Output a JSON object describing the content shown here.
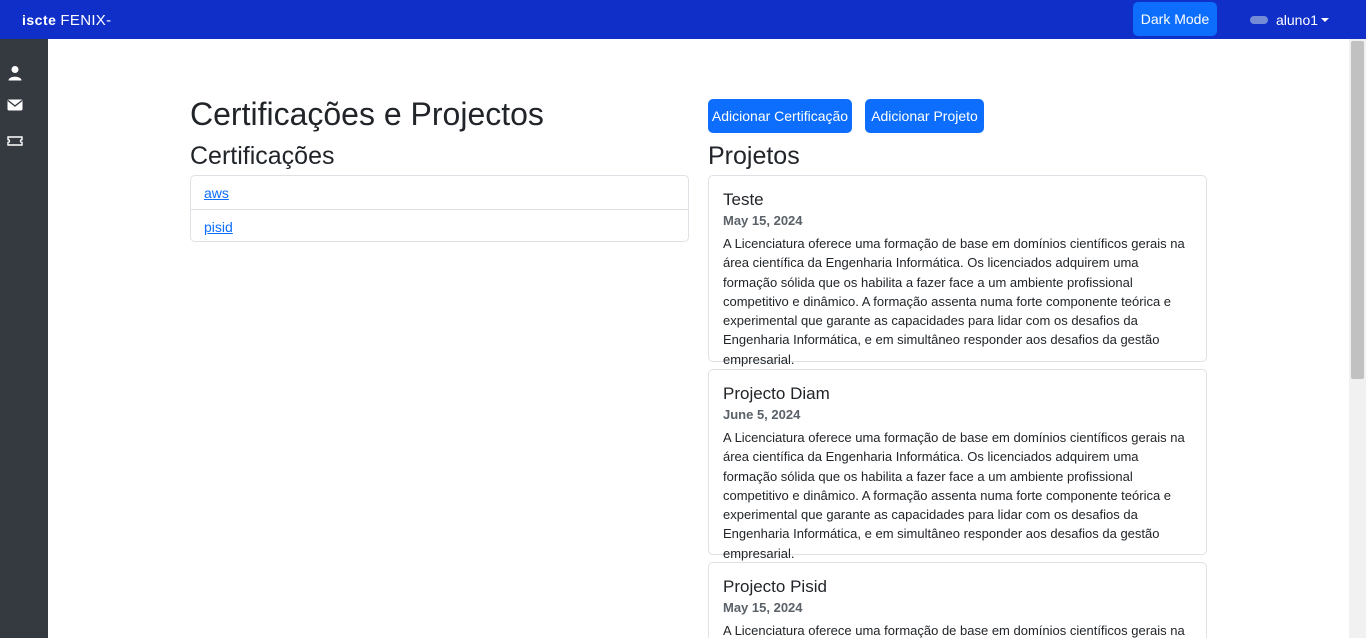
{
  "navbar": {
    "brand_logo": "iscte",
    "brand_name": "FENIX-",
    "dark_mode_label": "Dark Mode",
    "user_name": "aluno1"
  },
  "sidebar": {
    "icons": [
      "user-icon",
      "envelope-icon",
      "ticket-icon"
    ]
  },
  "page": {
    "title": "Certificações e Projectos",
    "certifications_heading": "Certificações",
    "projects_heading": "Projetos",
    "add_certification_label": "Adicionar Certificação",
    "add_project_label": "Adicionar Projeto"
  },
  "certifications": [
    {
      "label": "aws"
    },
    {
      "label": "pisid"
    }
  ],
  "projects": [
    {
      "title": "Teste",
      "date": "May 15, 2024",
      "description": "A Licenciatura oferece uma formação de base em domínios científicos gerais na área científica da Engenharia Informática. Os licenciados adquirem uma formação sólida que os habilita a fazer face a um ambiente profissional competitivo e dinâmico. A formação assenta numa forte componente teórica e experimental que garante as capacidades para lidar com os desafios da Engenharia Informática, e em simultâneo responder aos desafios da gestão empresarial."
    },
    {
      "title": "Projecto Diam",
      "date": "June 5, 2024",
      "description": "A Licenciatura oferece uma formação de base em domínios científicos gerais na área científica da Engenharia Informática. Os licenciados adquirem uma formação sólida que os habilita a fazer face a um ambiente profissional competitivo e dinâmico. A formação assenta numa forte componente teórica e experimental que garante as capacidades para lidar com os desafios da Engenharia Informática, e em simultâneo responder aos desafios da gestão empresarial."
    },
    {
      "title": "Projecto Pisid",
      "date": "May 15, 2024",
      "description": "A Licenciatura oferece uma formação de base em domínios científicos gerais na"
    }
  ],
  "colors": {
    "navbar": "#0f2fc8",
    "primary": "#0d6efd",
    "sidebar": "#343a40"
  }
}
